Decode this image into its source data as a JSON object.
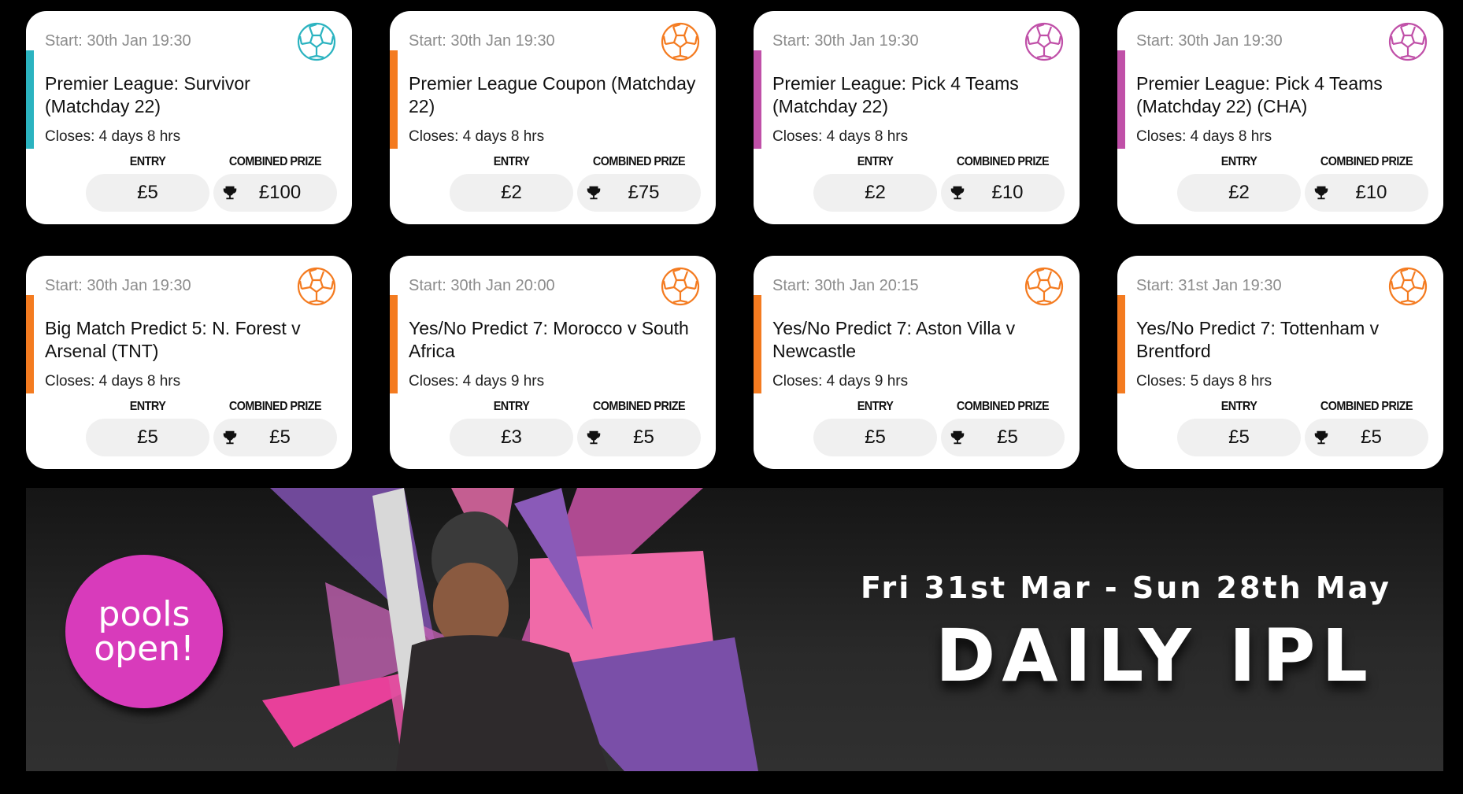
{
  "labels": {
    "entry": "ENTRY",
    "combined_prize": "COMBINED PRIZE"
  },
  "cards": [
    {
      "start": "Start: 30th Jan 19:30",
      "title": "Premier League: Survivor (Matchday 22)",
      "closes": "Closes: 4 days 8 hrs",
      "entry": "£5",
      "prize": "£100",
      "color": "#2bb3c0",
      "icon": "football-icon"
    },
    {
      "start": "Start: 30th Jan 19:30",
      "title": "Premier League Coupon (Matchday 22)",
      "closes": "Closes: 4 days 8 hrs",
      "entry": "£2",
      "prize": "£75",
      "color": "#f47b20",
      "icon": "football-icon"
    },
    {
      "start": "Start: 30th Jan 19:30",
      "title": "Premier League: Pick 4 Teams (Matchday 22)",
      "closes": "Closes: 4 days 8 hrs",
      "entry": "£2",
      "prize": "£10",
      "color": "#c050a8",
      "icon": "football-icon"
    },
    {
      "start": "Start: 30th Jan 19:30",
      "title": "Premier League: Pick 4 Teams (Matchday 22) (CHA)",
      "closes": "Closes: 4 days 8 hrs",
      "entry": "£2",
      "prize": "£10",
      "color": "#c050a8",
      "icon": "football-icon"
    },
    {
      "start": "Start: 30th Jan 19:30",
      "title": "Big Match Predict 5: N. Forest v Arsenal (TNT)",
      "closes": "Closes: 4 days 8 hrs",
      "entry": "£5",
      "prize": "£5",
      "color": "#f47b20",
      "icon": "football-icon"
    },
    {
      "start": "Start: 30th Jan 20:00",
      "title": "Yes/No Predict 7: Morocco v South Africa",
      "closes": "Closes: 4 days 9 hrs",
      "entry": "£3",
      "prize": "£5",
      "color": "#f47b20",
      "icon": "football-icon"
    },
    {
      "start": "Start: 30th Jan 20:15",
      "title": "Yes/No Predict 7: Aston Villa v Newcastle",
      "closes": "Closes: 4 days 9 hrs",
      "entry": "£5",
      "prize": "£5",
      "color": "#f47b20",
      "icon": "football-icon"
    },
    {
      "start": "Start: 31st Jan 19:30",
      "title": "Yes/No Predict 7: Tottenham v Brentford",
      "closes": "Closes: 5 days 8 hrs",
      "entry": "£5",
      "prize": "£5",
      "color": "#f47b20",
      "icon": "football-icon"
    }
  ],
  "banner": {
    "badge_line1": "pools",
    "badge_line2": "open!",
    "dates": "Fri 31st Mar - Sun 28th May",
    "headline": "DAILY IPL"
  }
}
